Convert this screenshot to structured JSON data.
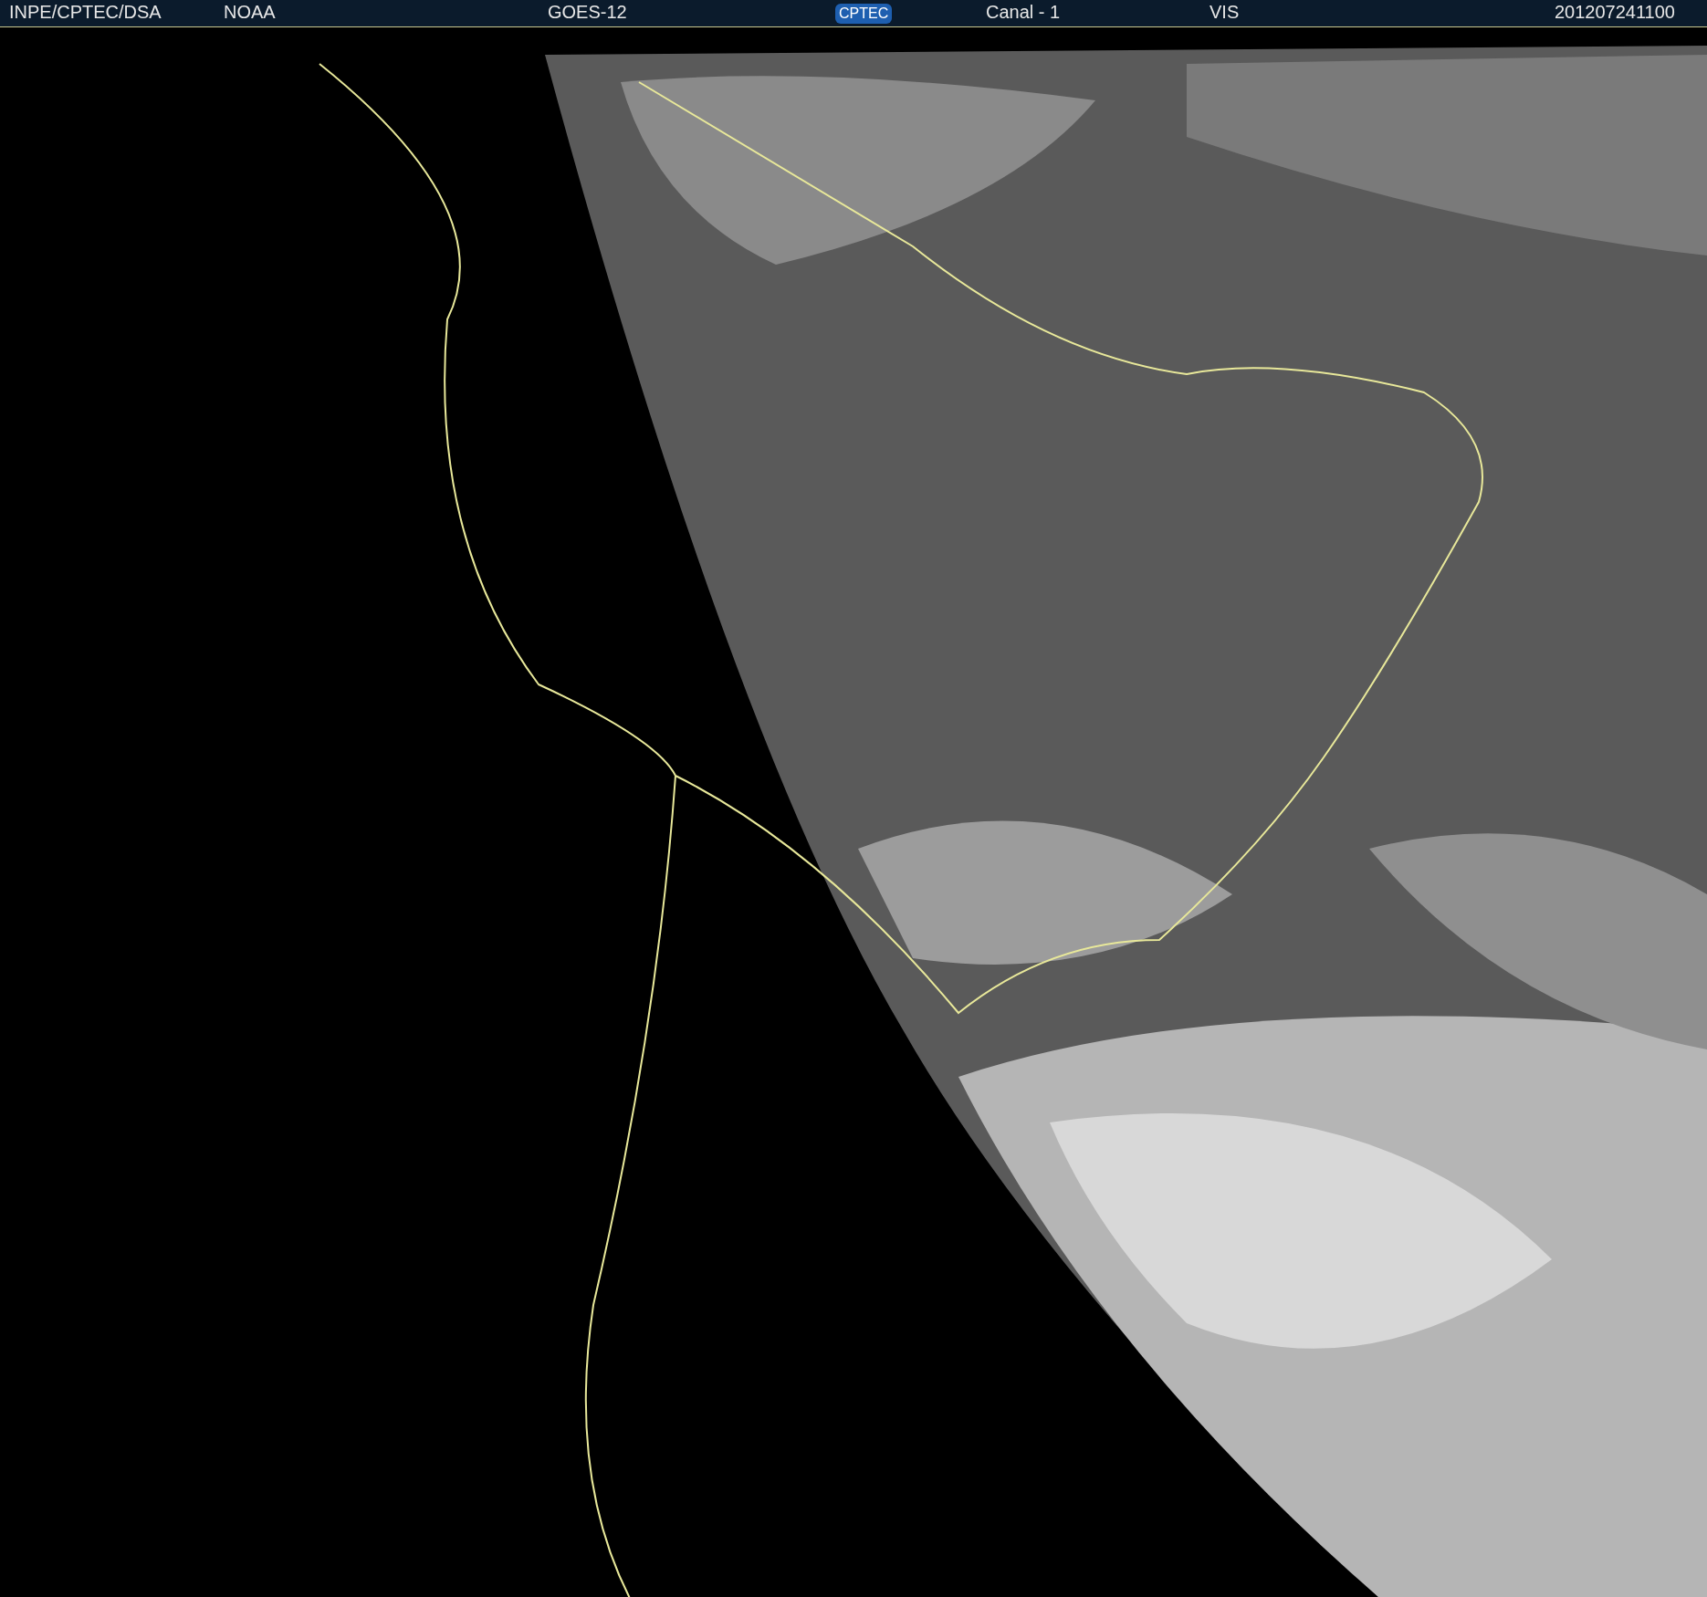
{
  "header": {
    "source": "INPE/CPTEC/DSA",
    "agency": "NOAA",
    "satellite": "GOES-12",
    "logo": "CPTEC",
    "channel": "Canal - 1",
    "band": "VIS",
    "timestamp": "201207241100"
  }
}
